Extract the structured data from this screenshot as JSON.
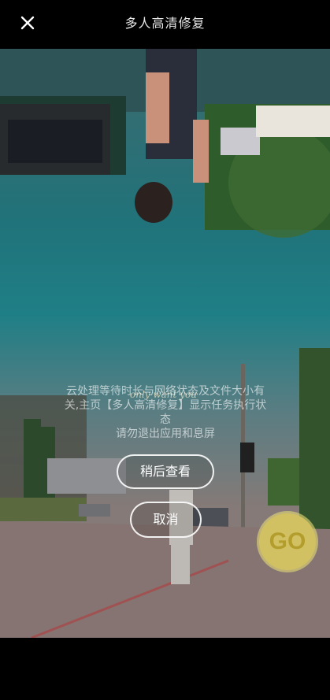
{
  "header": {
    "title": "多人高清修复",
    "close_icon": "close-icon"
  },
  "overlay": {
    "lines": [
      "云处理等待时长与网络状态及文件大小有",
      "关,主页【多人高清修复】显示任务执行状",
      "态",
      "请勿退出应用和息屏"
    ],
    "later_button": "稍后查看",
    "cancel_button": "取消"
  },
  "photo": {
    "script_text": "only want you",
    "badge_text": "GO"
  }
}
